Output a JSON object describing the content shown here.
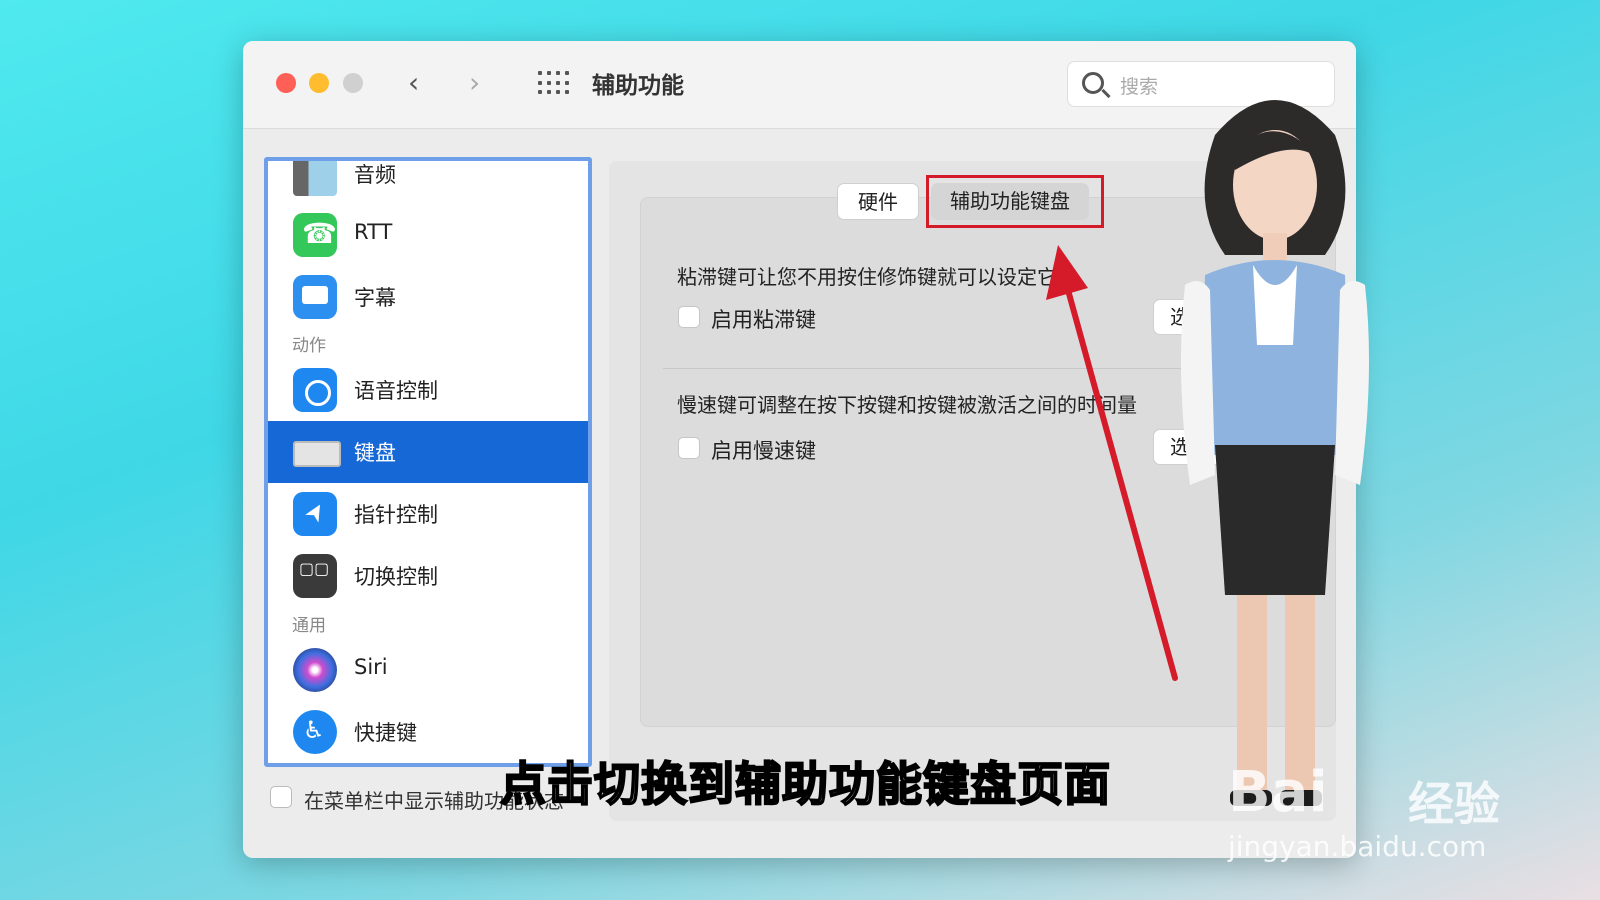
{
  "window": {
    "title": "辅助功能"
  },
  "search": {
    "placeholder": "搜索"
  },
  "sidebar": {
    "items": [
      {
        "label": "音频",
        "icon": "speaker-icon"
      },
      {
        "label": "RTT",
        "icon": "rtt-phone-icon"
      },
      {
        "label": "字幕",
        "icon": "captions-icon"
      },
      {
        "label": "语音控制",
        "icon": "voice-control-icon"
      },
      {
        "label": "键盘",
        "icon": "keyboard-icon",
        "selected": true
      },
      {
        "label": "指针控制",
        "icon": "pointer-icon"
      },
      {
        "label": "切换控制",
        "icon": "switch-control-icon"
      },
      {
        "label": "Siri",
        "icon": "siri-icon"
      },
      {
        "label": "快捷键",
        "icon": "shortcut-icon"
      }
    ],
    "sections": {
      "motor": "动作",
      "general": "通用"
    }
  },
  "footer": {
    "show_status_label": "在菜单栏中显示辅助功能状态"
  },
  "tabs": {
    "hardware": "硬件",
    "accessibility_keyboard": "辅助功能键盘"
  },
  "sticky_keys": {
    "description": "粘滞键可让您不用按住修饰键就可以设定它。",
    "checkbox_label": "启用粘滞键",
    "options_label": "选"
  },
  "slow_keys": {
    "description": "慢速键可调整在按下按键和按键被激活之间的时间量",
    "checkbox_label": "启用慢速键",
    "options_label": "选"
  },
  "overlay": {
    "subtitle": "点击切换到辅助功能键盘页面",
    "watermark_brand": "Bai",
    "watermark_brand2": "经验",
    "watermark_url": "jingyan.baidu.com",
    "accent_color": "#d51b2a"
  }
}
